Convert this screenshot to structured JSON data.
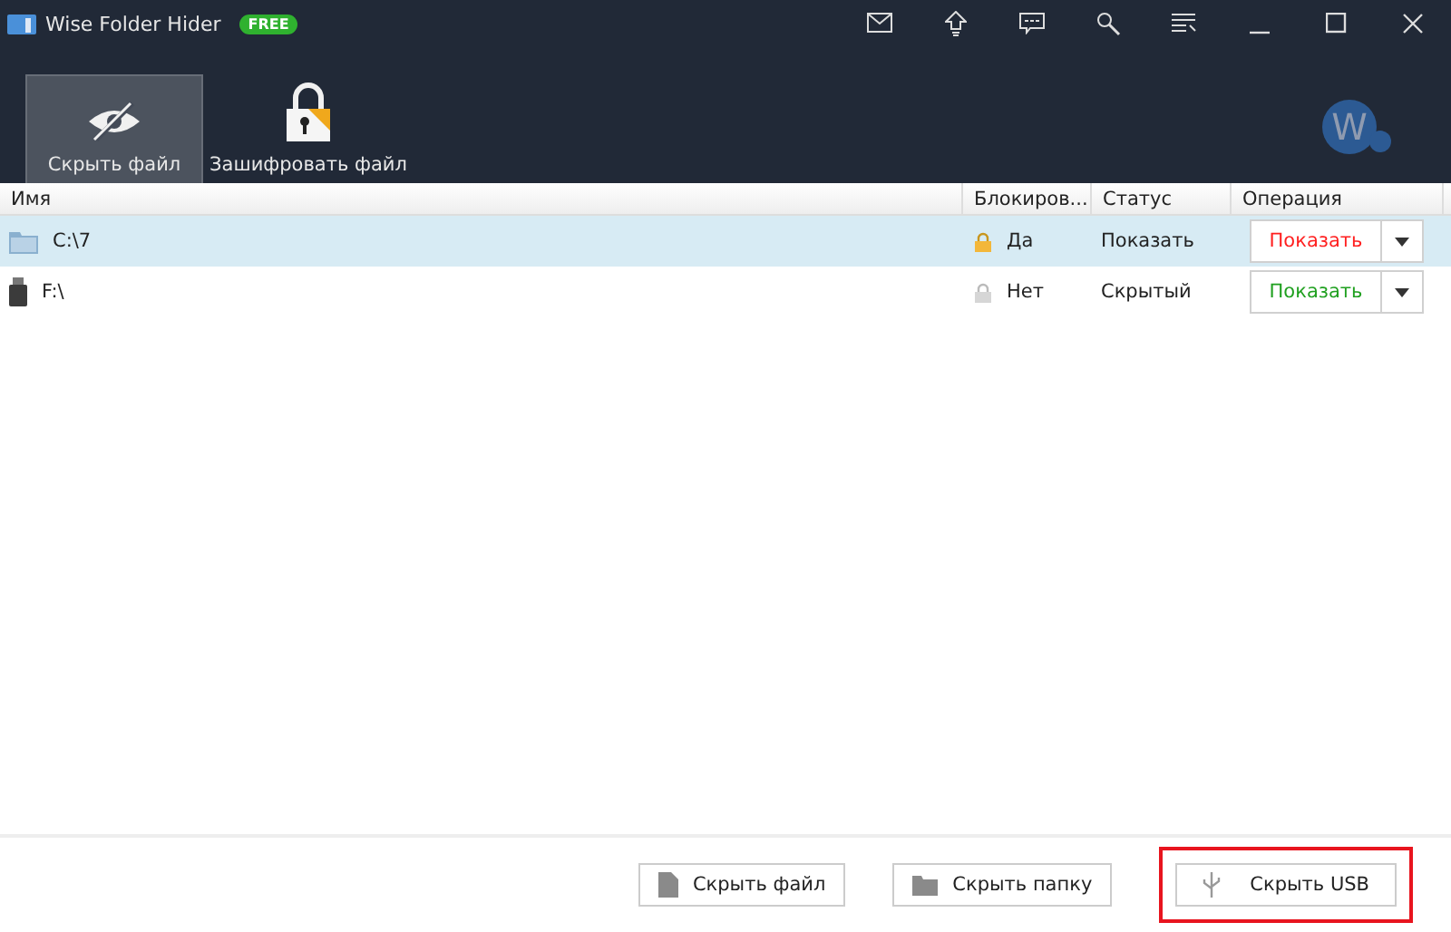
{
  "window": {
    "title": "Wise Folder Hider",
    "badge": "FREE"
  },
  "toolbar": [
    {
      "label": "Скрыть файл",
      "kind": "hide",
      "selected": true
    },
    {
      "label": "Зашифровать файл",
      "kind": "encrypt",
      "selected": false
    }
  ],
  "avatar": {
    "letter": "W"
  },
  "table": {
    "columns": [
      "Имя",
      "Блокиров...",
      "Статус",
      "Операция"
    ],
    "rows": [
      {
        "name": "C:\\7",
        "kind": "folder",
        "locked": true,
        "lock_label": "Да",
        "status": "Показать",
        "operation": "Показать",
        "color": "#ff2020",
        "selected": true
      },
      {
        "name": "F:\\",
        "kind": "usb",
        "locked": false,
        "lock_label": "Нет",
        "status": "Скрытый",
        "operation": "Показать",
        "color": "#20a020",
        "selected": false
      }
    ]
  },
  "buttons": [
    {
      "label": "Скрыть файл",
      "kind": "file",
      "highlighted": false
    },
    {
      "label": "Скрыть папку",
      "kind": "folder",
      "highlighted": false
    },
    {
      "label": "Скрыть USB",
      "kind": "usb",
      "highlighted": true
    }
  ]
}
